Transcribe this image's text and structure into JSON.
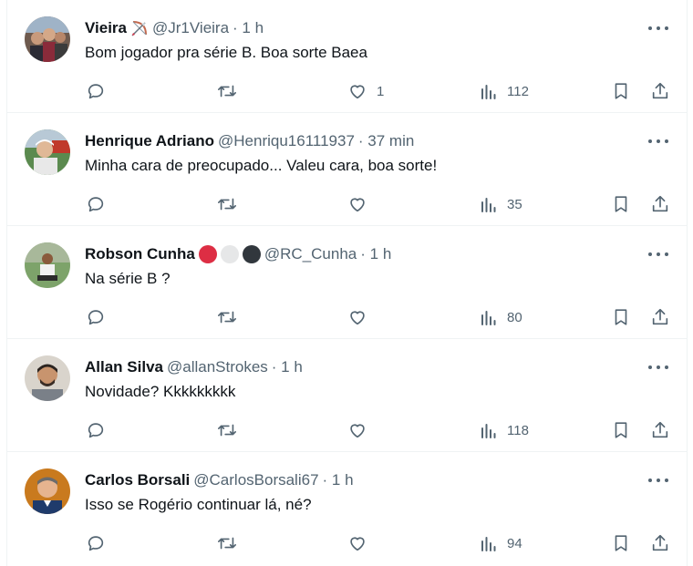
{
  "replies": [
    {
      "name": "Vieira",
      "emoji": "bow-and-arrow",
      "handle": "@Jr1Vieira",
      "time": "· 1 h",
      "text": "Bom jogador pra série B. Boa sorte Baea",
      "likes": "1",
      "views": "112"
    },
    {
      "name": "Henrique Adriano",
      "handle": "@Henriqu16111937",
      "time": "· 37 min",
      "text": "Minha cara de preocupado... Valeu cara, boa sorte!",
      "likes": "",
      "views": "35"
    },
    {
      "name": "Robson Cunha",
      "emoji_colors": [
        "#dd2e44",
        "#e6e7e8",
        "#31373d"
      ],
      "handle": "@RC_Cunha",
      "time": "· 1 h",
      "text": "Na série B ?",
      "likes": "",
      "views": "80"
    },
    {
      "name": "Allan Silva",
      "handle": "@allanStrokes",
      "time": "· 1 h",
      "text": "Novidade? Kkkkkkkkk",
      "likes": "",
      "views": "118"
    },
    {
      "name": "Carlos Borsali",
      "handle": "@CarlosBorsali67",
      "time": "· 1 h",
      "text": "Isso se Rogério continuar lá, né?",
      "likes": "",
      "views": "94"
    }
  ],
  "icons": {
    "more": "more-icon",
    "reply": "reply-icon",
    "retweet": "retweet-icon",
    "like": "like-icon",
    "views": "views-icon",
    "bookmark": "bookmark-icon",
    "share": "share-icon"
  },
  "colors": {
    "text": "#0f1419",
    "secondary": "#536471",
    "divider": "#eff3f4"
  }
}
